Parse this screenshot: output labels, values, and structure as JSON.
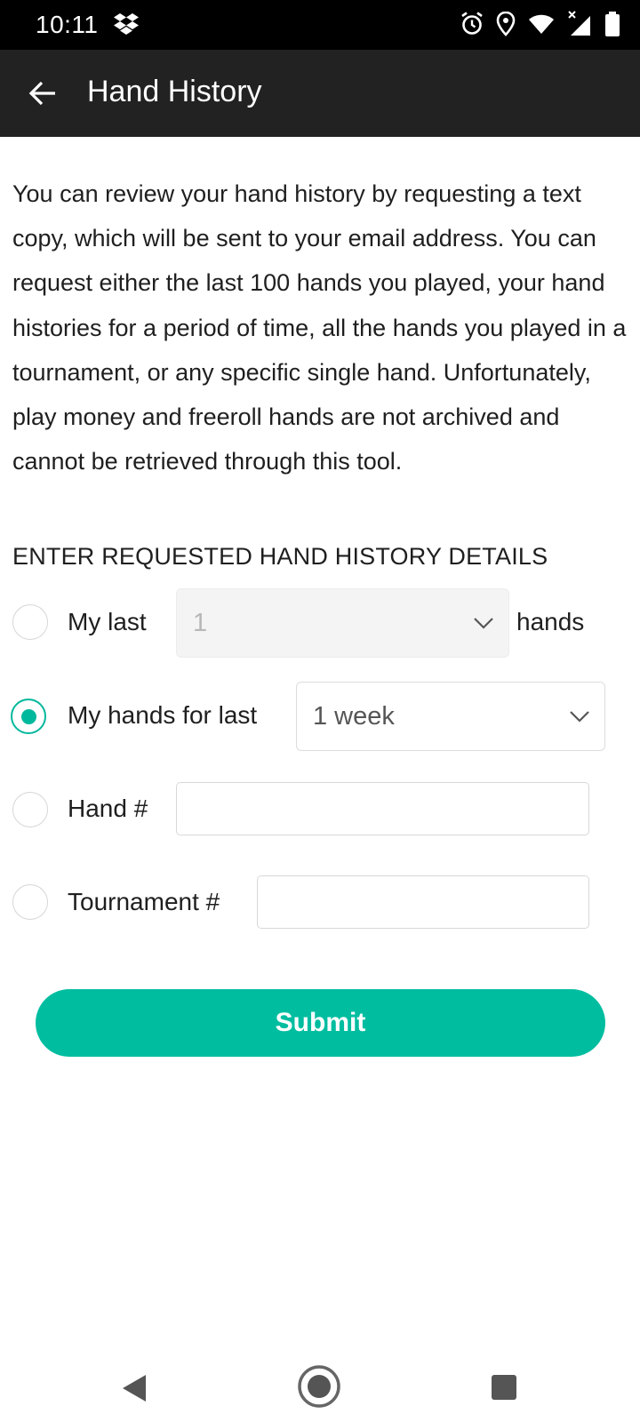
{
  "status_bar": {
    "time": "10:11",
    "icons": [
      "dropbox-icon",
      "alarm-icon",
      "location-icon",
      "wifi-icon",
      "signal-icon",
      "battery-icon"
    ]
  },
  "app_bar": {
    "title": "Hand History",
    "back_icon": "arrow-left-icon"
  },
  "intro_text": "You can review your hand history by requesting a text copy, which will be sent to your email address. You can request either the last 100 hands you played, your hand histories for a period of time, all the hands you played in a tournament, or any specific single hand. Unfortunately, play money and freeroll hands are not archived and cannot be retrieved through this tool.",
  "form": {
    "section_title": "ENTER REQUESTED HAND HISTORY DETAILS",
    "option_last_hands": {
      "label": "My last",
      "select_value": "1",
      "suffix": "hands",
      "checked": false,
      "disabled": true
    },
    "option_period": {
      "label": "My hands for last",
      "select_value": "1 week",
      "checked": true
    },
    "option_hand_number": {
      "label": "Hand #",
      "value": "",
      "checked": false
    },
    "option_tournament": {
      "label": "Tournament #",
      "value": "",
      "checked": false
    },
    "submit_label": "Submit"
  },
  "colors": {
    "accent": "#00bda0",
    "app_bar": "#222222",
    "status_bar": "#000000"
  },
  "nav_bar": {
    "icons": [
      "back-triangle-icon",
      "home-circle-icon",
      "recents-square-icon"
    ]
  }
}
